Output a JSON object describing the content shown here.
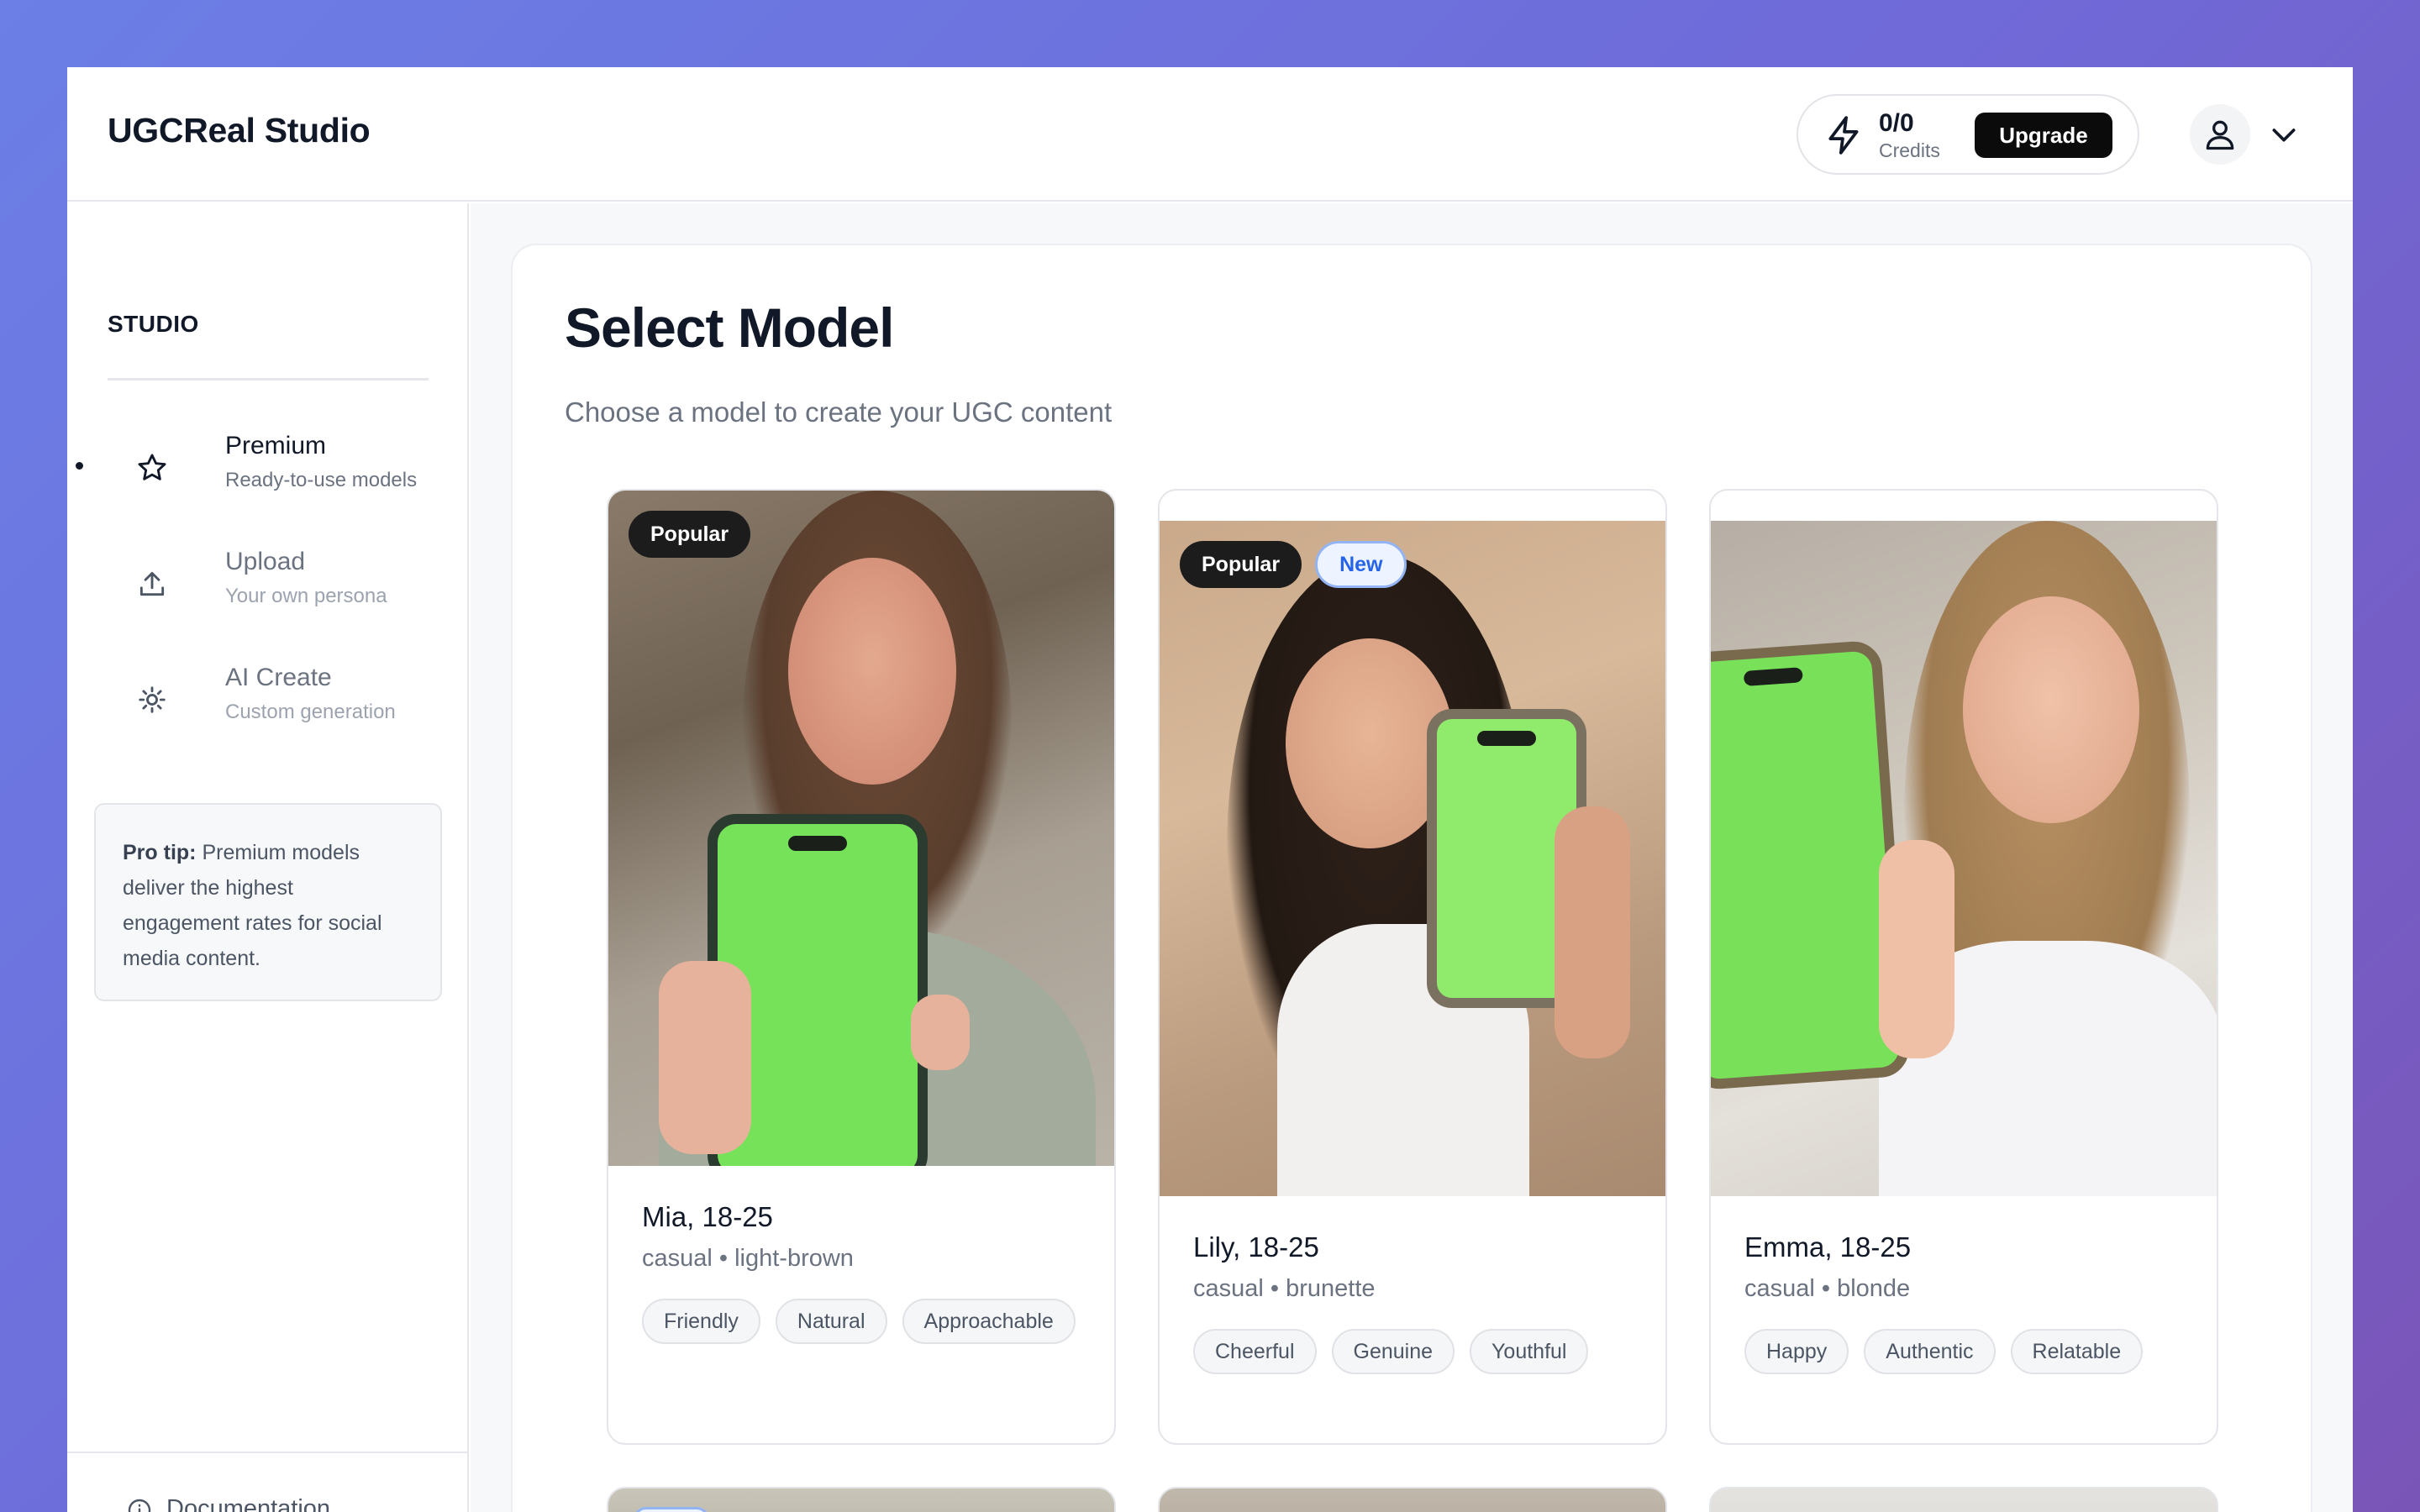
{
  "app": {
    "title": "UGCReal Studio"
  },
  "header": {
    "credits_value": "0/0",
    "credits_label": "Credits",
    "upgrade_label": "Upgrade"
  },
  "sidebar": {
    "section_title": "STUDIO",
    "items": [
      {
        "label": "Premium",
        "sub": "Ready-to-use models",
        "icon": "star-icon",
        "active": true
      },
      {
        "label": "Upload",
        "sub": "Your own persona",
        "icon": "upload-icon",
        "active": false
      },
      {
        "label": "AI Create",
        "sub": "Custom generation",
        "icon": "sparkle-icon",
        "active": false
      }
    ],
    "tip_prefix": "Pro tip:",
    "tip_text": "Premium models deliver the highest engagement rates for social media content.",
    "documentation_label": "Documentation"
  },
  "main": {
    "title": "Select Model",
    "subtitle": "Choose a model to create your UGC content",
    "models": [
      {
        "name": "Mia, 18-25",
        "meta": "casual • light-brown",
        "badges": [
          "Popular"
        ],
        "tags": [
          "Friendly",
          "Natural",
          "Approachable"
        ]
      },
      {
        "name": "Lily, 18-25",
        "meta": "casual • brunette",
        "badges": [
          "Popular",
          "New"
        ],
        "tags": [
          "Cheerful",
          "Genuine",
          "Youthful"
        ]
      },
      {
        "name": "Emma, 18-25",
        "meta": "casual • blonde",
        "badges": [],
        "tags": [
          "Happy",
          "Authentic",
          "Relatable"
        ]
      }
    ]
  },
  "colors": {
    "accent": "#0b0b0b",
    "phone_screen": "#76e25a",
    "badge_new": "#2563eb"
  }
}
